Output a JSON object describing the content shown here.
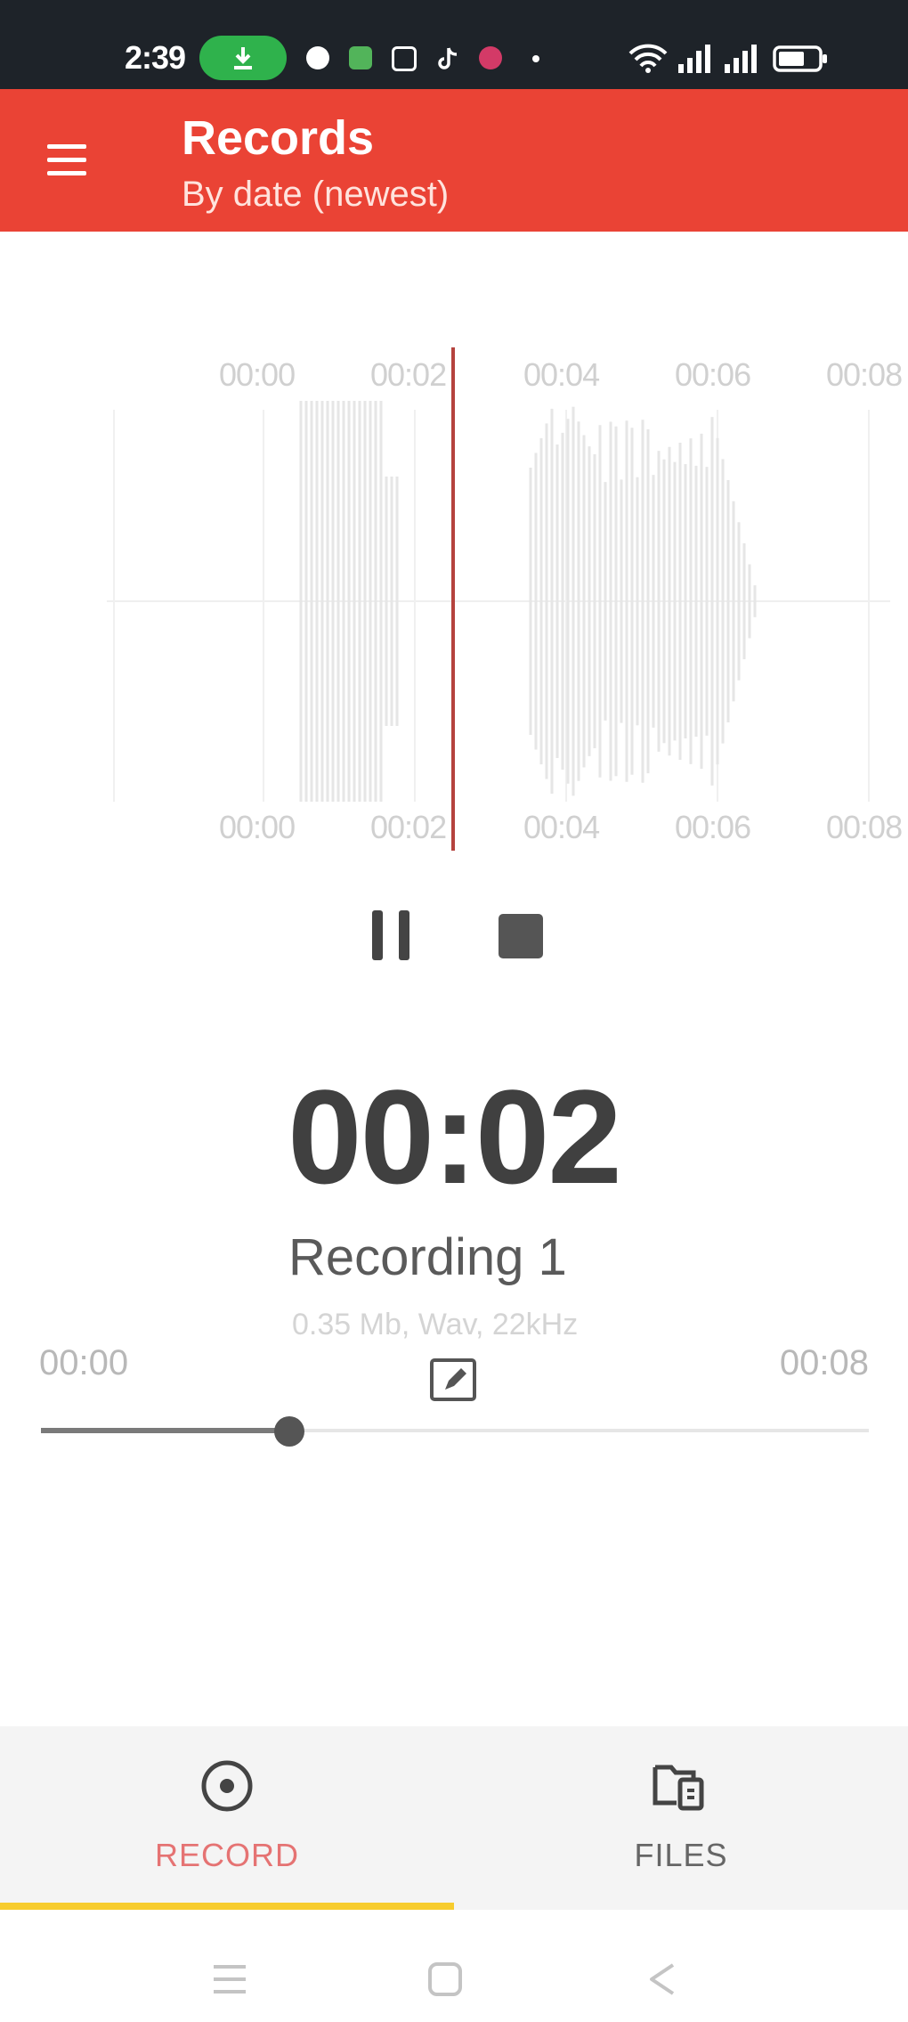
{
  "status_bar": {
    "time": "2:39",
    "icons": [
      "download-icon",
      "notification-icon",
      "app-icon",
      "gallery-icon",
      "tiktok-icon",
      "app-badge-icon",
      "dot-icon",
      "wifi-icon",
      "signal-icon",
      "signal-icon",
      "battery-icon"
    ]
  },
  "app_bar": {
    "title": "Records",
    "subtitle": "By date (newest)",
    "menu_icon": "menu-icon",
    "color": "#ea4335"
  },
  "waveform": {
    "top_ticks": [
      "00:00",
      "00:02",
      "00:04",
      "00:06",
      "00:08"
    ],
    "bottom_ticks": [
      "00:00",
      "00:02",
      "00:04",
      "00:06",
      "00:08"
    ],
    "playhead_color": "#b5433e"
  },
  "controls": {
    "pause_icon": "pause-icon",
    "stop_icon": "stop-icon"
  },
  "recording": {
    "elapsed": "00:02",
    "name": "Recording 1",
    "info": "0.35 Mb, Wav, 22kHz",
    "position_start": "00:00",
    "position_end": "00:08",
    "progress": 0.3,
    "edit_icon": "edit-icon"
  },
  "bottom_nav": {
    "tabs": [
      {
        "label": "RECORD",
        "icon": "record-icon",
        "active": true,
        "color": "#e57373"
      },
      {
        "label": "FILES",
        "icon": "files-icon",
        "active": false,
        "color": "#666666"
      }
    ],
    "indicator_color": "#f7cc2e"
  },
  "system_nav": {
    "buttons": [
      "recent-apps-icon",
      "home-icon",
      "back-icon"
    ]
  }
}
